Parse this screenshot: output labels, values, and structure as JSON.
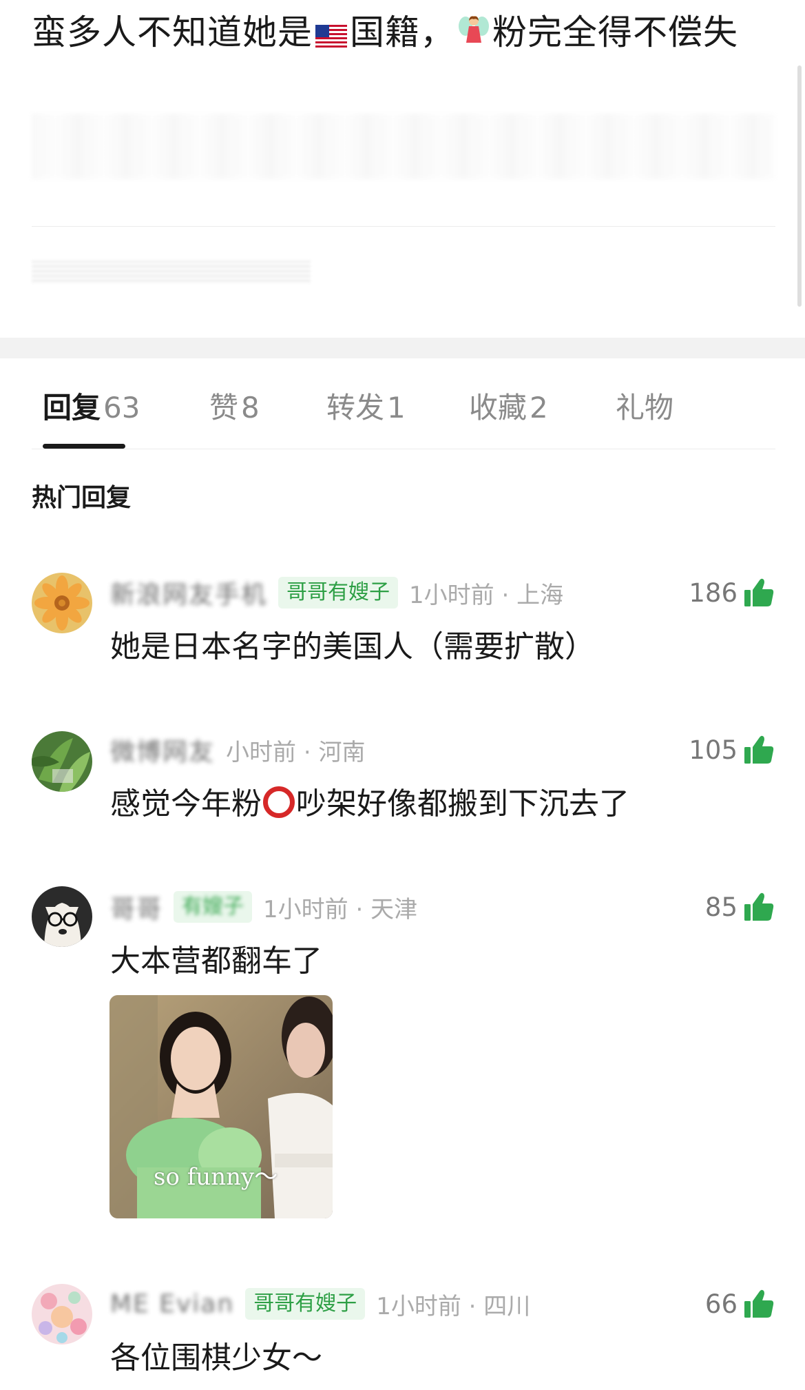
{
  "post": {
    "title_part1": "蛮多人不知道她是",
    "flag_icon": "us-flag-icon",
    "title_part2": "国籍，",
    "fairy_icon": "fairy-icon",
    "title_part3": "粉完全得不偿失"
  },
  "tabs": [
    {
      "label": "回复",
      "count": "63",
      "active": true
    },
    {
      "label": "赞",
      "count": "8"
    },
    {
      "label": "转发",
      "count": "1"
    },
    {
      "label": "收藏",
      "count": "2"
    },
    {
      "label": "礼物",
      "count": ""
    }
  ],
  "hot_replies_heading": "热门回复",
  "comments": [
    {
      "username": "新浪网友手机",
      "badge": "哥哥有嫂子",
      "time": "1小时前",
      "location": "上海",
      "time_location": "1小时前 · 上海",
      "likes": "186",
      "text": "她是日本名字的美国人（需要扩散）"
    },
    {
      "username": "微博网友",
      "time_location": "小时前 · 河南",
      "likes": "105",
      "text_part1": "感觉今年粉",
      "ring_icon": "red-circle-icon",
      "text_part2": "吵架好像都搬到下沉去了"
    },
    {
      "username": "哥哥",
      "badge": "有嫂子",
      "time_location": "1小时前 · 天津",
      "likes": "85",
      "text": "大本营都翻车了",
      "gif_caption": "so funny～"
    },
    {
      "username": "ME Evian",
      "badge": "哥哥有嫂子",
      "time_location": "1小时前 · 四川",
      "likes": "66",
      "text": "各位围棋少女～"
    }
  ],
  "colors": {
    "like_green": "#2fa84f",
    "badge_bg": "#eaf7ec",
    "badge_text": "#2d9f45",
    "muted": "#aaaaaa"
  }
}
